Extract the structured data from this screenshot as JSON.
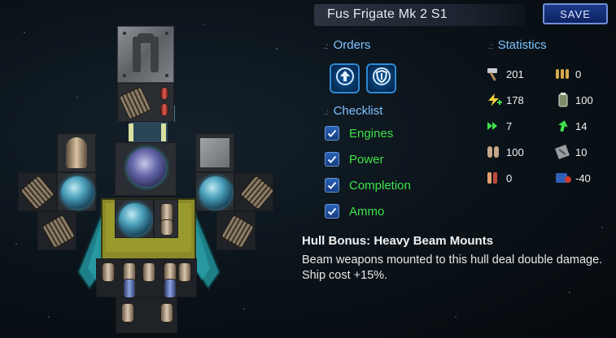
{
  "ship": {
    "name": "Fus Frigate Mk 2 S1"
  },
  "toolbar": {
    "save_label": "SAVE"
  },
  "orders": {
    "heading": "Orders",
    "buttons": [
      {
        "icon": "arrow-up-icon"
      },
      {
        "icon": "shield-icon"
      }
    ]
  },
  "checklist": {
    "heading": "Checklist",
    "items": [
      {
        "label": "Engines",
        "checked": true
      },
      {
        "label": "Power",
        "checked": true
      },
      {
        "label": "Completion",
        "checked": true
      },
      {
        "label": "Ammo",
        "checked": true
      }
    ]
  },
  "statistics": {
    "heading": "Statistics",
    "rows": [
      {
        "left": {
          "icon": "hammer-icon",
          "value": "201"
        },
        "right": {
          "icon": "ammo-icon",
          "value": "0"
        }
      },
      {
        "left": {
          "icon": "power-icon",
          "value": "178"
        },
        "right": {
          "icon": "canister-icon",
          "value": "100"
        }
      },
      {
        "left": {
          "icon": "thrust-icon",
          "value": "7"
        },
        "right": {
          "icon": "turn-icon",
          "value": "14"
        }
      },
      {
        "left": {
          "icon": "cells-icon",
          "value": "100"
        },
        "right": {
          "icon": "armor-icon",
          "value": "10"
        }
      },
      {
        "left": {
          "icon": "ammo-red-icon",
          "value": "0"
        },
        "right": {
          "icon": "crew-icon",
          "value": "-40"
        }
      }
    ]
  },
  "hull_bonus": {
    "title": "Hull Bonus: Heavy Beam Mounts",
    "description": "Beam weapons mounted to this hull deal double damage. Ship cost +15%."
  },
  "colors": {
    "accent": "#7fc3ff",
    "check_text": "#3fe24a",
    "save_border": "#6f8fd8"
  }
}
